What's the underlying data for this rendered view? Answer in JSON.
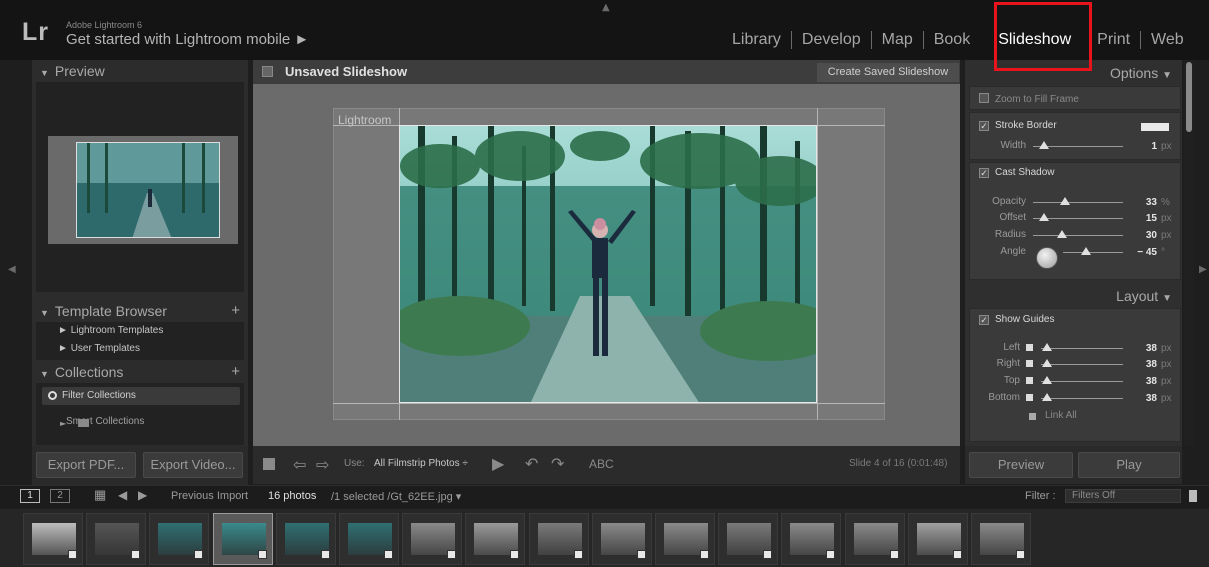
{
  "app": {
    "logo": "Lr",
    "subtitle": "Adobe Lightroom 6",
    "promo": "Get started with Lightroom mobile ►"
  },
  "modules": [
    {
      "label": "Library",
      "active": false
    },
    {
      "label": "Develop",
      "active": false
    },
    {
      "label": "Map",
      "active": false
    },
    {
      "label": "Book",
      "active": false
    },
    {
      "label": "Slideshow",
      "active": true
    },
    {
      "label": "Print",
      "active": false
    },
    {
      "label": "Web",
      "active": false
    }
  ],
  "left_panel": {
    "preview_header": "Preview",
    "template_header": "Template Browser",
    "templates": [
      "Lightroom Templates",
      "User Templates"
    ],
    "collections_header": "Collections",
    "filter_collections": "Filter Collections",
    "smart_collections": "Smart Collections",
    "export_pdf": "Export PDF...",
    "export_video": "Export Video..."
  },
  "center": {
    "title": "Unsaved Slideshow",
    "create_saved": "Create Saved Slideshow",
    "watermark": "Lightroom",
    "toolbar": {
      "use_label": "Use:",
      "use_value": "All Filmstrip Photos ÷",
      "abc": "ABC",
      "status": "Slide 4 of 16 (0:01:48)"
    }
  },
  "right_panel": {
    "options_header": "Options",
    "zoom_to_fill": "Zoom to Fill Frame",
    "stroke_border": "Stroke Border",
    "width_label": "Width",
    "width_value": "1",
    "cast_shadow": "Cast Shadow",
    "shadow": [
      {
        "label": "Opacity",
        "value": "33",
        "unit": "%",
        "level": 0.33
      },
      {
        "label": "Offset",
        "value": "15",
        "unit": "px",
        "level": 0.12
      },
      {
        "label": "Radius",
        "value": "30",
        "unit": "px",
        "level": 0.3
      },
      {
        "label": "Angle",
        "value": "− 45",
        "unit": "°",
        "level": 0.35
      }
    ],
    "layout_header": "Layout",
    "show_guides": "Show Guides",
    "guides": [
      {
        "label": "Left",
        "value": "38",
        "unit": "px"
      },
      {
        "label": "Right",
        "value": "38",
        "unit": "px"
      },
      {
        "label": "Top",
        "value": "38",
        "unit": "px"
      },
      {
        "label": "Bottom",
        "value": "38",
        "unit": "px"
      }
    ],
    "link_all": "Link All",
    "preview_button": "Preview",
    "play_button": "Play"
  },
  "filmstrip_bar": {
    "page1": "1",
    "page2": "2",
    "source": "Previous Import",
    "count": "16 photos",
    "selection": "/1 selected /Gt_62EE.jpg ▾",
    "filter_label": "Filter :",
    "filter_value": "Filters Off"
  },
  "filmstrip": {
    "count": 16,
    "selected_index": 3
  },
  "colors": {
    "accent_highlight": "#e8141c",
    "photo_tint": "#2a6d72"
  }
}
